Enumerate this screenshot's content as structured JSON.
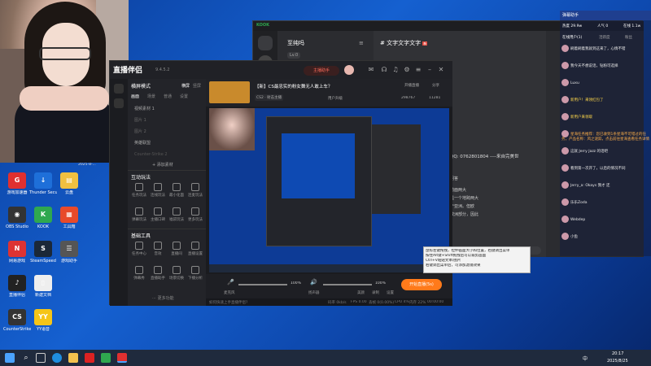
{
  "desktop": {
    "icons": [
      {
        "label": "游戏加速器",
        "color": "#e03030",
        "glyph": "G"
      },
      {
        "label": "Thunder Secure",
        "color": "#1e6fd9",
        "glyph": "↓"
      },
      {
        "label": "云盘",
        "color": "#f0c040",
        "glyph": "▤"
      },
      {
        "label": "OBS Studio",
        "color": "#333",
        "glyph": "◉"
      },
      {
        "label": "KOOK",
        "color": "#2fa84f",
        "glyph": "K"
      },
      {
        "label": "工具箱",
        "color": "#e84a2a",
        "glyph": "▦"
      },
      {
        "label": "网易游戏",
        "color": "#d33",
        "glyph": "N"
      },
      {
        "label": "SteamSpeed",
        "color": "#1b2838",
        "glyph": "S"
      },
      {
        "label": "游戏助手",
        "color": "#555",
        "glyph": "☰"
      },
      {
        "label": "直播伴侣",
        "color": "#222",
        "glyph": "♪"
      },
      {
        "label": "新建文档",
        "color": "#eee",
        "glyph": "▯"
      },
      {
        "label": "CounterStrike",
        "color": "#333",
        "glyph": "CS"
      },
      {
        "label": "YY语音",
        "color": "#f5c518",
        "glyph": "YY"
      }
    ],
    "datetime_overlay": "2025-8-..."
  },
  "app": {
    "name": "直播伴侣",
    "version": "9.4.5.2",
    "live_button": "主播助手",
    "left": {
      "mode": "横屏模式",
      "mode_tabs": [
        "横屏",
        "竖屏"
      ],
      "scene_tabs": [
        "画面",
        "场景",
        "普通",
        "设置"
      ],
      "scenes": [
        "视频素材 1",
        "图片 1",
        "图片 2",
        "英雄联盟",
        "Counter-Strike 2"
      ],
      "add_material": "+ 添加素材",
      "interact_title": "互动玩法",
      "interact_tools": [
        "任务玩法",
        "连线玩法",
        "最小化面",
        "连麦玩法",
        "弹幕玩法",
        "主播口碑",
        "福袋玩法",
        "更多玩法"
      ],
      "basic_title": "基础工具",
      "basic_tools": [
        "任务中心",
        "音效",
        "直播间",
        "直播设置",
        "弹幕秀",
        "直播助手",
        "场景切换",
        "下播分析"
      ],
      "more": "更多功能"
    },
    "stream": {
      "title": "【新】CS最忠实的粉女舞无人敢上车？",
      "category": "CS2 · 射击主播",
      "action1": "开播直播",
      "action2": "分享",
      "stats": [
        "298767",
        "11281"
      ],
      "rank": "用户升级",
      "start_live": "开始直播(5s)"
    },
    "controls": {
      "mic": "麦克风",
      "mic_vol": "100%",
      "speaker": "扬声器",
      "speaker_vol": "100%",
      "beauty": "美颜",
      "record": "录制",
      "settings": "设置"
    },
    "status": {
      "tip": "如何快速上手直播伴侣?",
      "bitrate": "码率 0kb/s",
      "fps": "FPS 0.00",
      "drop": "丢帧 0(0.00%)",
      "cpu": "CPU 4%",
      "mem": "内存 22%",
      "time": "00:00:00"
    }
  },
  "kook": {
    "server": "至纯吗",
    "level": "Lv.0",
    "channel": "文字文字文字",
    "message": "QQ: 0762801804 ----来自完美世",
    "snippets": [
      "前面两大",
      "是一个地跨两大",
      "于亚洲。但欧",
      "欧洲部分，因此"
    ],
    "question": "问答"
  },
  "helper": {
    "title": "弹幕助手",
    "heat": "热度 29.9w",
    "popularity": "人气 0",
    "online": "在线 1.1w",
    "tabs": [
      "在线用户(1)",
      "活跃度",
      "粉丝"
    ],
    "messages": [
      "刷着刷着我就到这来了，心情不错",
      "我今天不想说话，钻粉可选择",
      "Luxu",
      "新用户！来领红包了",
      "新用户来领取",
      "星海任务推荐：您已收到1条星海不可错过的任务，产品名称：风之谜踪，点击前往星海查看任务详情",
      "这就 Jerry Jazz 的话吧",
      "看到第一次开了，以后的情况不同",
      "Jerry_a: Okays 我才 还",
      "乐乐Zoda",
      "Webdep",
      "小鱼"
    ]
  },
  "tooltip": {
    "lines": [
      "鼠标左键拖拽，拉伸画面大小和位置，右键调出菜单",
      "按住Alt键+Shift拖拽后可以裁剪画面",
      "Ctrl+V粘贴文本/图片",
      "右键调出菜单后，可添加滤镜效果"
    ]
  },
  "taskbar": {
    "time": "20:17",
    "date": "2025/8/25",
    "lang": "中"
  },
  "colors": {
    "accent": "#ff7a1a",
    "live": "#ff5a4a",
    "kook_green": "#2fa84f"
  }
}
